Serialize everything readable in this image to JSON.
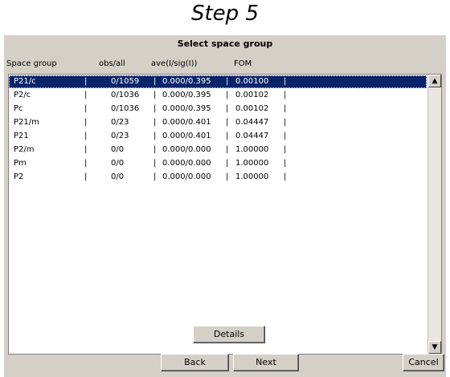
{
  "page_title": "Step 5",
  "dialog": {
    "title": "Select space group",
    "columns": [
      "Space group",
      "obs/all",
      "ave(I/sig(I))",
      "FOM"
    ],
    "rows": [
      {
        "sg": "P21/c",
        "obs": "0/1059",
        "ave": "0.000/0.395",
        "fom": "0.00100",
        "selected": true
      },
      {
        "sg": "P2/c",
        "obs": "0/1036",
        "ave": "0.000/0.395",
        "fom": "0.00102"
      },
      {
        "sg": "Pc",
        "obs": "0/1036",
        "ave": "0.000/0.395",
        "fom": "0.00102"
      },
      {
        "sg": "P21/m",
        "obs": "0/23",
        "ave": "0.000/0.401",
        "fom": "0.04447"
      },
      {
        "sg": "P21",
        "obs": "0/23",
        "ave": "0.000/0.401",
        "fom": "0.04447"
      },
      {
        "sg": "P2/m",
        "obs": "0/0",
        "ave": "0.000/0.000",
        "fom": "1.00000"
      },
      {
        "sg": "Pm",
        "obs": "0/0",
        "ave": "0.000/0.000",
        "fom": "1.00000"
      },
      {
        "sg": "P2",
        "obs": "0/0",
        "ave": "0.000/0.000",
        "fom": "1.00000"
      }
    ],
    "separator": "|",
    "scroll_up_icon": "▲",
    "scroll_down_icon": "▼",
    "buttons": {
      "details": "Details",
      "back": "Back",
      "next": "Next",
      "cancel": "Cancel"
    },
    "colors": {
      "selection": "#0a246a",
      "panel": "#d4d0c8"
    }
  }
}
